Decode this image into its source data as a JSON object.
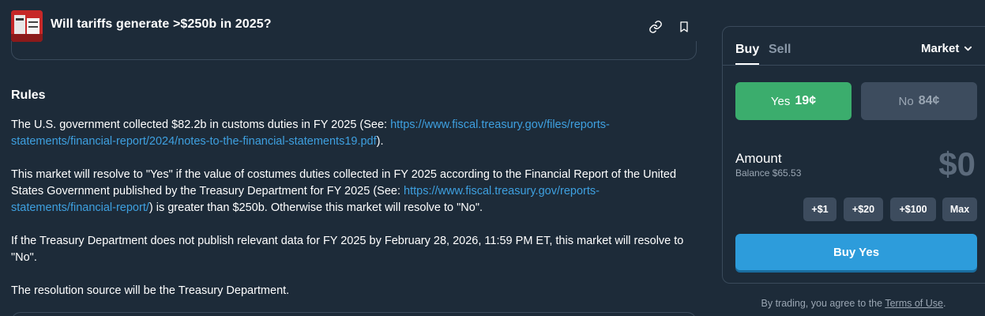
{
  "header": {
    "title": "Will tariffs generate >$250b in 2025?",
    "thumbnail_icon": "tariff-image",
    "link_icon": "link-icon",
    "bookmark_icon": "bookmark-icon"
  },
  "rules": {
    "heading": "Rules",
    "p1_text": "The U.S. government collected $82.2b in customs duties in FY 2025 (See: ",
    "p1_link": "https://www.fiscal.treasury.gov/files/reports-statements/financial-report/2024/notes-to-the-financial-statements19.pdf",
    "p1_end": ").",
    "p2_text": "This market will resolve to \"Yes\" if the value of costumes duties collected in FY 2025 according to the Financial Report of the United States Government published by the Treasury Department for FY 2025 (See: ",
    "p2_link": "https://www.fiscal.treasury.gov/reports-statements/financial-report/",
    "p2_end": ") is greater than $250b. Otherwise this market will resolve to \"No\".",
    "p3": "If the Treasury Department does not publish relevant data for FY 2025 by February 28, 2026, 11:59 PM ET, this market will resolve to \"No\".",
    "p4": "The resolution source will be the Treasury Department."
  },
  "trade": {
    "tab_buy": "Buy",
    "tab_sell": "Sell",
    "order_type": "Market",
    "yes_label": "Yes",
    "yes_price": "19¢",
    "no_label": "No",
    "no_price": "84¢",
    "amount_label": "Amount",
    "balance": "Balance $65.53",
    "amount_value": "$0",
    "quick": [
      "+$1",
      "+$20",
      "+$100",
      "Max"
    ],
    "buy_button": "Buy Yes",
    "terms_prefix": "By trading, you agree to the ",
    "terms_link": "Terms of Use",
    "terms_suffix": "."
  },
  "colors": {
    "background": "#1d2b39",
    "yes": "#3bad6d",
    "buy": "#2d9cdb",
    "link": "#3ea0e0"
  }
}
